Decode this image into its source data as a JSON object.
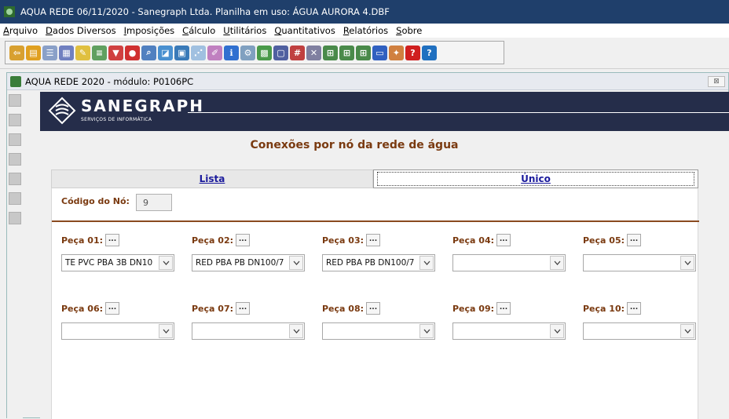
{
  "window": {
    "title": "AQUA REDE 06/11/2020 - Sanegraph Ltda. Planilha em uso: ÁGUA  AURORA 4.DBF"
  },
  "menu": [
    "Arquivo",
    "Dados Diversos",
    "Imposições",
    "Cálculo",
    "Utilitários",
    "Quantitativos",
    "Relatórios",
    "Sobre"
  ],
  "child_window": {
    "title": "AQUA REDE 2020 - módulo: P0106PC",
    "close": "⊠"
  },
  "banner": {
    "logo": "SANEGRAPH",
    "sub": "SERVIÇOS DE INFORMÁTICA"
  },
  "form": {
    "heading": "Conexões por nó da rede de água",
    "tab_lista": "Lista",
    "tab_unico": "Único",
    "codigo_label": "Código do Nó:",
    "codigo_value": "9",
    "dots": "..."
  },
  "pecas": [
    {
      "label": "Peça 01:",
      "value": "TE PVC PBA 3B DN10"
    },
    {
      "label": "Peça 02:",
      "value": "RED PBA PB DN100/7"
    },
    {
      "label": "Peça 03:",
      "value": "RED PBA PB DN100/7"
    },
    {
      "label": "Peça 04:",
      "value": ""
    },
    {
      "label": "Peça 05:",
      "value": ""
    },
    {
      "label": "Peça 06:",
      "value": ""
    },
    {
      "label": "Peça 07:",
      "value": ""
    },
    {
      "label": "Peça 08:",
      "value": ""
    },
    {
      "label": "Peça 09:",
      "value": ""
    },
    {
      "label": "Peça 10:",
      "value": ""
    }
  ],
  "colors": {
    "titlebar": "#1f3f6b",
    "banner": "#252d4a",
    "label": "#7a3a10",
    "tab_link": "#1a1a9c"
  }
}
